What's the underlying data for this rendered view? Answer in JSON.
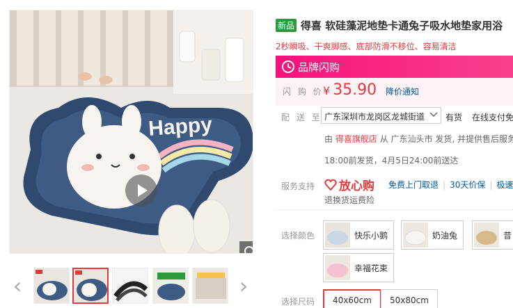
{
  "gallery": {
    "thumb_count": 5,
    "active_thumb": 2
  },
  "product": {
    "new_badge": "新品",
    "title": "得喜 软硅藻泥地垫卡通兔子吸水地垫家用浴",
    "subtitle": "2秒瞬吸、干爽脚感、底部防滑不移位、容易清洁",
    "mat_text": "Happy"
  },
  "flash": {
    "label": "品牌闪购"
  },
  "price": {
    "label": "闪 购 价",
    "currency": "¥",
    "amount": "35.90",
    "notify": "降价通知"
  },
  "delivery": {
    "label": "配 送 至",
    "address": "广东深圳市龙岗区龙城街道",
    "stock": "有货",
    "pay": "在线支付免",
    "shipper_prefix": "由",
    "store": "得喜旗舰店",
    "shipper_suffix": "从 广东汕头市 发货, 并提供售后服务",
    "time": "18:00前发货，4月5日24:00前送达"
  },
  "service": {
    "label": "服务支持",
    "badge": "放心购",
    "links": [
      "免费上门取退",
      "30天价保",
      "极速"
    ],
    "extra": "退换货运费险"
  },
  "colors": {
    "label": "选择颜色",
    "options": [
      {
        "label": "快乐小鹅"
      },
      {
        "label": "奶油兔"
      },
      {
        "label": "昔"
      },
      {
        "label": "幸福花束"
      }
    ]
  },
  "sizes": {
    "label": "选择尺码",
    "options": [
      "40x60cm",
      "50x80cm"
    ],
    "selected": 0
  },
  "theme": {
    "accent": "#e4393c",
    "flash_pink": "#f6127c",
    "link_blue": "#005aa0",
    "badge_green": "#2c9a3c"
  }
}
